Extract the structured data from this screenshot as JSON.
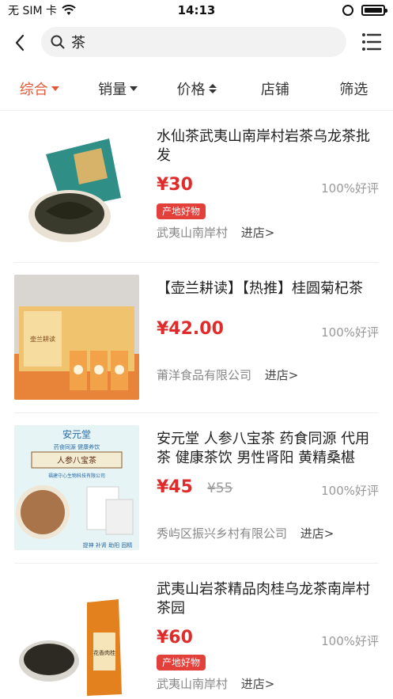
{
  "status": {
    "carrier": "无 SIM 卡",
    "time": "14:13"
  },
  "search": {
    "query": "茶"
  },
  "tabs": [
    {
      "label": "综合",
      "active": true
    },
    {
      "label": "销量"
    },
    {
      "label": "价格"
    },
    {
      "label": "店铺"
    },
    {
      "label": "筛选"
    }
  ],
  "items": [
    {
      "title": "水仙茶武夷山南岸村岩茶乌龙茶批发",
      "price": "¥30",
      "reviews": "100%好评",
      "badge": "产地好物",
      "shop": "武夷山南岸村",
      "enter": "进店>"
    },
    {
      "title": "【壶兰耕读】【热推】桂圆菊杞茶",
      "price": "¥42.00",
      "reviews": "100%好评",
      "shop": "莆洋食品有限公司",
      "enter": "进店>"
    },
    {
      "title": "安元堂 人参八宝茶 药食同源 代用茶 健康茶饮 男性肾阳 黄精桑椹",
      "price": "¥45",
      "original_price": "¥55",
      "reviews": "100%好评",
      "shop": "秀屿区振兴乡村有限公司",
      "enter": "进店>"
    },
    {
      "title": "武夷山岩茶精品肉桂乌龙茶南岸村茶园",
      "price": "¥60",
      "reviews": "100%好评",
      "badge": "产地好物",
      "shop": "武夷山南岸村",
      "enter": "进店>"
    }
  ],
  "images": {
    "item2_box_text": "壶兰耕读",
    "item3_brand": "安元堂",
    "item3_slogan": "药食同源 健康养饮",
    "item3_product": "人参八宝茶",
    "item3_company": "福建守心生物科技有限公司",
    "item3_footer": "提神 补肾 助阳 固精",
    "item4_pack": "花香肉桂"
  },
  "colors": {
    "accent": "#e15b3b",
    "price": "#e02b2b",
    "badge": "#e3403b"
  }
}
